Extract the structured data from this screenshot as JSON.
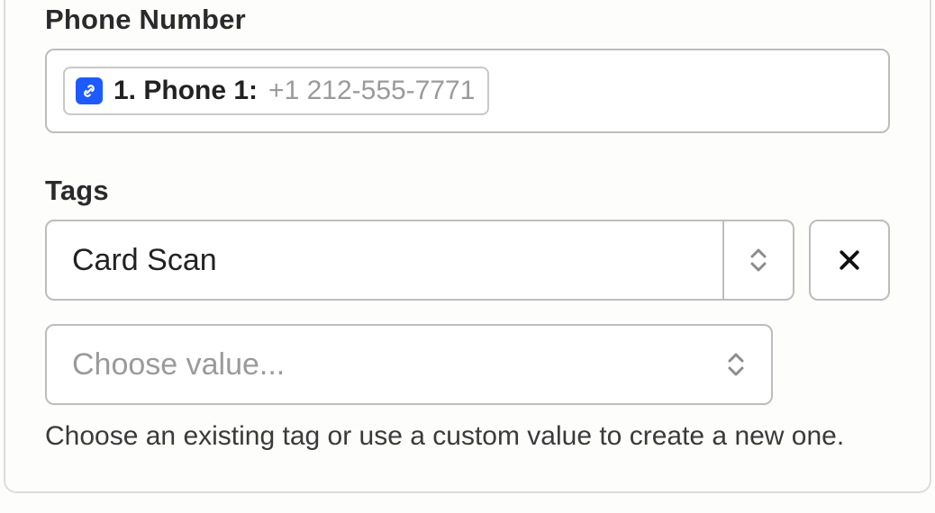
{
  "phone": {
    "label": "Phone Number",
    "chip": {
      "icon_name": "link-icon",
      "label": "1. Phone 1:",
      "value": "+1 212-555-7771"
    }
  },
  "tags": {
    "label": "Tags",
    "selected": "Card Scan",
    "placeholder": "Choose value...",
    "helper": "Choose an existing tag or use a custom value to create a new one."
  }
}
